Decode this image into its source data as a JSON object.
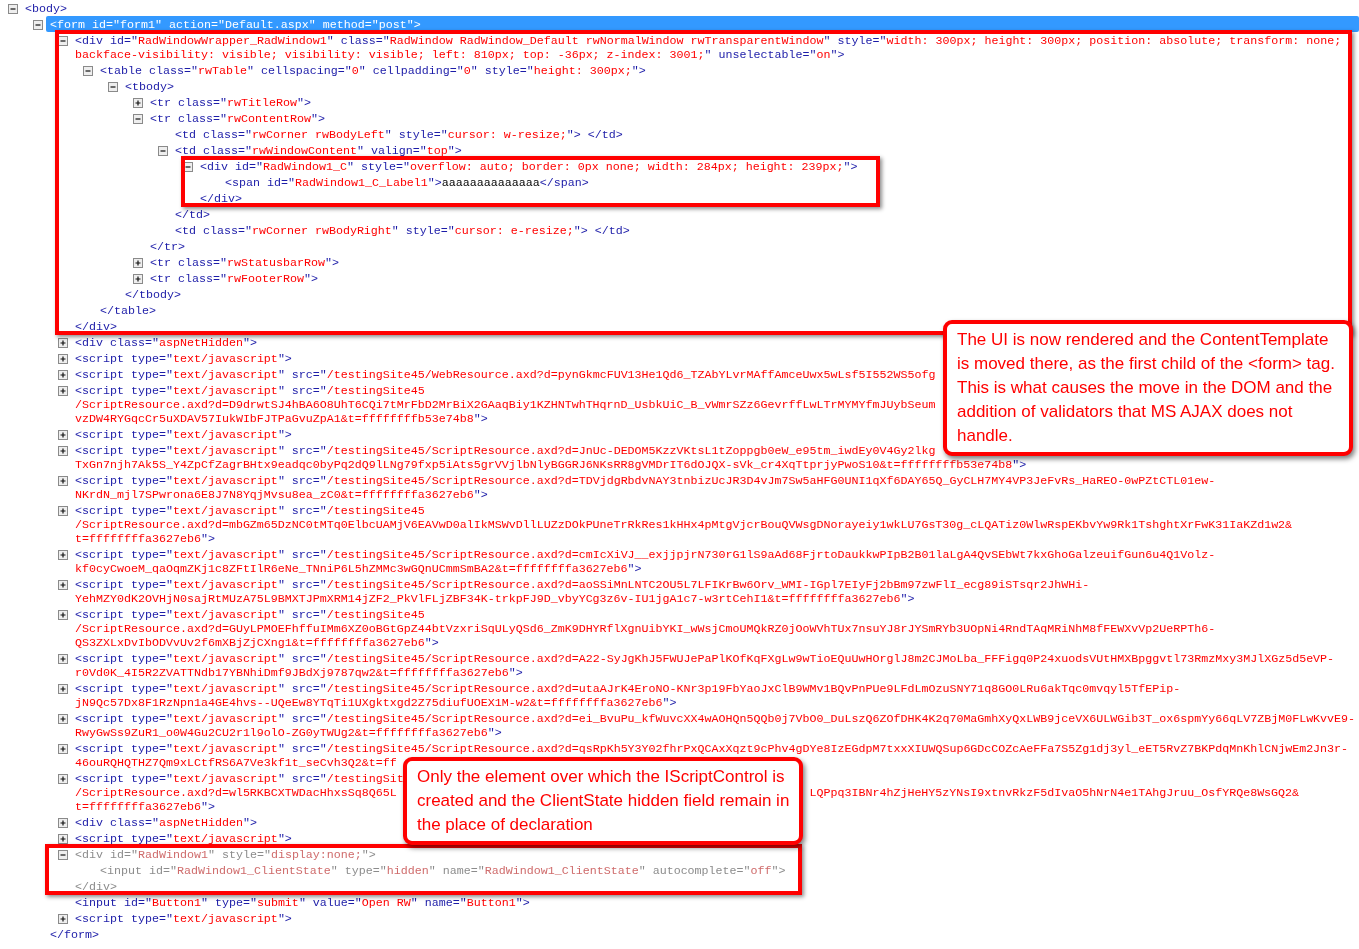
{
  "tree": [
    {
      "lines": [
        "<body>"
      ],
      "expanded": true,
      "selected": false,
      "dimmed": false,
      "outlined": false,
      "children": [
        {
          "lines": [
            "<form id=\"form1\" action=\"Default.aspx\" method=\"post\">"
          ],
          "expanded": true,
          "selected": true,
          "dimmed": false,
          "outlined": false,
          "children": [
            {
              "lines": [
                "<div id=\"RadWindowWrapper_RadWindow1\" class=\"RadWindow RadWindow_Default rwNormalWindow rwTransparentWindow\" style=\"width: 300px; height: 300px; position: absolute; transform: none;",
                "backface-visibility: visible; visibility: visible; left: 810px; top: -36px; z-index: 3001;\" unselectable=\"on\">"
              ],
              "expanded": true,
              "selected": false,
              "dimmed": false,
              "outlined": true,
              "children": [
                {
                  "lines": [
                    "<table class=\"rwTable\" cellspacing=\"0\" cellpadding=\"0\" style=\"height: 300px;\">"
                  ],
                  "expanded": true,
                  "selected": false,
                  "dimmed": false,
                  "outlined": false,
                  "children": [
                    {
                      "lines": [
                        "<tbody>"
                      ],
                      "expanded": true,
                      "selected": false,
                      "dimmed": false,
                      "outlined": false,
                      "children": [
                        {
                          "lines": [
                            "<tr class=\"rwTitleRow\">"
                          ],
                          "expanded": false,
                          "selected": false,
                          "dimmed": false,
                          "outlined": false
                        },
                        {
                          "lines": [
                            "<tr class=\"rwContentRow\">"
                          ],
                          "expanded": true,
                          "selected": false,
                          "dimmed": false,
                          "outlined": false,
                          "children": [
                            {
                              "lines": [
                                "<td class=\"rwCorner rwBodyLeft\" style=\"cursor: w-resize;\"> </td>"
                              ],
                              "selected": false,
                              "dimmed": false,
                              "outlined": false
                            },
                            {
                              "lines": [
                                "<td class=\"rwWindowContent\" valign=\"top\">"
                              ],
                              "expanded": true,
                              "selected": false,
                              "dimmed": false,
                              "outlined": false,
                              "children": [
                                {
                                  "lines": [
                                    "<div id=\"RadWindow1_C\" style=\"overflow: auto; border: 0px none; width: 284px; height: 239px;\">"
                                  ],
                                  "expanded": true,
                                  "selected": false,
                                  "dimmed": false,
                                  "outlined": true,
                                  "children": [
                                    {
                                      "lines": [
                                        "<span id=\"RadWindow1_C_Label1\">aaaaaaaaaaaaaa</span>"
                                      ],
                                      "selected": false,
                                      "dimmed": false,
                                      "outlined": false
                                    }
                                  ],
                                  "closing": "</div>"
                                }
                              ],
                              "closing": "</td>"
                            },
                            {
                              "lines": [
                                "<td class=\"rwCorner rwBodyRight\" style=\"cursor: e-resize;\"> </td>"
                              ],
                              "selected": false,
                              "dimmed": false,
                              "outlined": false
                            }
                          ],
                          "closing": "</tr>"
                        },
                        {
                          "lines": [
                            "<tr class=\"rwStatusbarRow\">"
                          ],
                          "expanded": false,
                          "selected": false,
                          "dimmed": false,
                          "outlined": false
                        },
                        {
                          "lines": [
                            "<tr class=\"rwFooterRow\">"
                          ],
                          "expanded": false,
                          "selected": false,
                          "dimmed": false,
                          "outlined": false
                        }
                      ],
                      "closing": "</tbody>"
                    }
                  ],
                  "closing": "</table>"
                }
              ],
              "closing": "</div>"
            },
            {
              "lines": [
                "<div class=\"aspNetHidden\">"
              ],
              "expanded": false,
              "selected": false,
              "dimmed": false,
              "outlined": false
            },
            {
              "lines": [
                "<script type=\"text/javascript\">"
              ],
              "expanded": false,
              "selected": false,
              "dimmed": false,
              "outlined": false
            },
            {
              "lines": [
                "<script type=\"text/javascript\" src=\"/testingSite45/WebResource.axd?d=pynGkmcFUV13He1Qd6_TZAbYLvrMAffAmceUwx5wLsf5I552WS5ofg"
              ],
              "expanded": false,
              "selected": false,
              "dimmed": false,
              "outlined": false
            },
            {
              "lines": [
                "<script type=\"text/javascript\" src=\"/testingSite45",
                "/ScriptResource.axd?d=D9drwtSJ4hBA6O8UhT6CQi7tMrFbD2MrBiX2GAaqBiy1KZHNTwhTHqrnD_UsbkUiC_B_vWmrSZz6GevrffLwLTrMYMYfmJUybSeum",
                "vzDW4RYGqcCr5uXDAV57IukWIbFJTPaGvuZpA1&t=ffffffffb53e74b8\">"
              ],
              "expanded": false,
              "selected": false,
              "dimmed": false,
              "outlined": false
            },
            {
              "lines": [
                "<script type=\"text/javascript\">"
              ],
              "expanded": false,
              "selected": false,
              "dimmed": false,
              "outlined": false
            },
            {
              "lines": [
                "<script type=\"text/javascript\" src=\"/testingSite45/ScriptResource.axd?d=JnUc-DEDOM5KzzVKtsL1tZoppgb0eW_e95tm_iwdEy0V4Gy2lkg",
                "TxGn7njh7Ak5S_Y4ZpCfZagrBHtx9eadqc0byPq2dQ9lLNg79fxp5iAts5grVVjlbNlyBGGRJ6NKsRR8gVMDrIT6dOJQX-sVk_cr4XqTtprjyPwoS10&t=ffffffffb53e74b8\">"
              ],
              "expanded": false,
              "selected": false,
              "dimmed": false,
              "outlined": false
            },
            {
              "lines": [
                "<script type=\"text/javascript\" src=\"/testingSite45/ScriptResource.axd?d=TDVjdgRbdvNAY3tnbizUcJR3D4vJm7Sw5aHFG0UNI1qXf6DAY65Q_GyCLH7MY4VP3JeFvRs_HaREO-0wPZtCTL01ew-",
                "NKrdN_mjl7SPwrona6E8J7N8YqjMvsu8ea_zC0&t=ffffffffa3627eb6\">"
              ],
              "expanded": false,
              "selected": false,
              "dimmed": false,
              "outlined": false
            },
            {
              "lines": [
                "<script type=\"text/javascript\" src=\"/testingSite45",
                "/ScriptResource.axd?d=mbGZm65DzNC0tMTq0ElbcUAMjV6EAVwD0alIkMSWvDllLUZzDOkPUneTrRkRes1kHHx4pMtgVjcrBouQVWsgDNorayeiy1wkLU7GsT30g_cLQATiz0WlwRspEKbvYw9Rk1TshghtXrFwK31IaKZd1w2&",
                "t=ffffffffa3627eb6\">"
              ],
              "expanded": false,
              "selected": false,
              "dimmed": false,
              "outlined": false
            },
            {
              "lines": [
                "<script type=\"text/javascript\" src=\"/testingSite45/ScriptResource.axd?d=cmIcXiVJ__exjjpjrN730rG1lS9aAd68FjrtoDaukkwPIpB2B01laLgA4QvSEbWt7kxGhoGalzeuifGun6u4Q1Volz-",
                "kf0cyCwoeM_qaOqmZKj1c8ZFtIlR6eNe_TNniP6L5hZMMc3wGQnUCmmSmBA2&t=ffffffffa3627eb6\">"
              ],
              "expanded": false,
              "selected": false,
              "dimmed": false,
              "outlined": false
            },
            {
              "lines": [
                "<script type=\"text/javascript\" src=\"/testingSite45/ScriptResource.axd?d=aoSSiMnLNTC2OU5L7LFIKrBw6Orv_WMI-IGpl7EIyFj2bBm97zwFlI_ecg89iSTsqr2JhWHi-",
                "YehMZY0dK2OVHjN0sajRtMUzA75L9BMXTJPmXRM14jZF2_PkVlFLjZBF34K-trkpFJ9D_vbyYCg3z6v-IU1jgA1c7-w3rtCehI1&t=ffffffffa3627eb6\">"
              ],
              "expanded": false,
              "selected": false,
              "dimmed": false,
              "outlined": false
            },
            {
              "lines": [
                "<script type=\"text/javascript\" src=\"/testingSite45",
                "/ScriptResource.axd?d=GUyLPMOEFhffuIMm6XZ0oBGtGpZ44btVzxriSqULyQSd6_ZmK9DHYRflXgnUibYKI_wWsjCmoUMQkRZ0jOoWVhTUx7nsuYJ8rJYSmRYb3UOpNi4RndTAqMRiNhM8fFEWXvVp2UeRPTh6-",
                "QS3ZXLxDvIbODVvUv2f6mXBjZjCXng1&t=ffffffffa3627eb6\">"
              ],
              "expanded": false,
              "selected": false,
              "dimmed": false,
              "outlined": false
            },
            {
              "lines": [
                "<script type=\"text/javascript\" src=\"/testingSite45/ScriptResource.axd?d=A22-SyJgKhJ5FWUJePaPlKOfKqFXgLw9wTioEQuUwHOrglJ8m2CJMoLba_FFFigq0P24xuodsVUtHMXBpggvtl73RmzMxy3MJlXGz5d5eVP-",
                "r0Vd0K_4I5R2ZVATTNdb17YBNhiDmf9JBdXj9787qw2&t=ffffffffa3627eb6\">"
              ],
              "expanded": false,
              "selected": false,
              "dimmed": false,
              "outlined": false
            },
            {
              "lines": [
                "<script type=\"text/javascript\" src=\"/testingSite45/ScriptResource.axd?d=utaAJrK4EroNO-KNr3p19FbYaoJxClB9WMv1BQvPnPUe9LFdLmOzuSNY71q8GO0LRu6akTqc0mvqyl5TfEPip-",
                "jN9Qc57Dx8F1RzNpn1a4GE4hvs--UQeEw8YTqTi1UXgktxgd2Z75diufUOEX1M-w2&t=ffffffffa3627eb6\">"
              ],
              "expanded": false,
              "selected": false,
              "dimmed": false,
              "outlined": false
            },
            {
              "lines": [
                "<script type=\"text/javascript\" src=\"/testingSite45/ScriptResource.axd?d=ei_BvuPu_kfWuvcXX4wAOHQn5QQb0j7VbO0_DuLszQ6ZOfDHK4K2q70MaGmhXyQxLWB9jceVX6ULWGib3T_ox6spmYy66qLV7ZBjM0FLwKvvE9-",
                "RwyGwSs9ZuR1_o0W4Gu2CU2r1l9olO-ZG0yTWUg2&t=ffffffffa3627eb6\">"
              ],
              "expanded": false,
              "selected": false,
              "dimmed": false,
              "outlined": false
            },
            {
              "lines": [
                "<script type=\"text/javascript\" src=\"/testingSite45/ScriptResource.axd?d=qsRpKh5Y3Y02fhrPxQCAxXqzt9cPhv4gDYe8IzEGdpM7txxXIUWQSup6GDcCOZcAeFFa7S5Zg1dj3yl_eET5RvZ7BKPdqMnKhlCNjwEm2Jn3r-",
                "46ouRQHQTHZ7Qm9xLCtfRS6A7Ve3kf1t_seCvh3Q2&t=ff"
              ],
              "expanded": false,
              "selected": false,
              "dimmed": false,
              "outlined": false
            },
            {
              "lines": [
                "<script type=\"text/javascript\" src=\"/testingSit",
                [
                  "/ScriptResource.axd?d=wl5RKBCXTWDacHhxsSq8Q65L",
                  "LQPpq3IBNr4hZjHeHY5zYNsI9xtnvRkzF5dIvaO5hNrN4e1TAhgJruu_OsfYRQe8WsGQ2&"
                ],
                "t=ffffffffa3627eb6\">"
              ],
              "expanded": false,
              "selected": false,
              "dimmed": false,
              "outlined": false
            },
            {
              "lines": [
                "<div class=\"aspNetHidden\">"
              ],
              "expanded": false,
              "selected": false,
              "dimmed": false,
              "outlined": false
            },
            {
              "lines": [
                "<script type=\"text/javascript\">"
              ],
              "expanded": false,
              "selected": false,
              "dimmed": false,
              "outlined": false
            },
            {
              "lines": [
                "<div id=\"RadWindow1\" style=\"display:none;\">"
              ],
              "expanded": true,
              "selected": false,
              "dimmed": true,
              "outlined": true,
              "children": [
                {
                  "lines": [
                    "<input id=\"RadWindow1_ClientState\" type=\"hidden\" name=\"RadWindow1_ClientState\" autocomplete=\"off\">"
                  ],
                  "selected": false,
                  "dimmed": true,
                  "outlined": false
                }
              ],
              "closing": "</div>"
            },
            {
              "lines": [
                "<input id=\"Button1\" type=\"submit\" value=\"Open RW\" name=\"Button1\">"
              ],
              "selected": false,
              "dimmed": false,
              "outlined": false
            },
            {
              "lines": [
                "<script type=\"text/javascript\">"
              ],
              "expanded": false,
              "selected": false,
              "dimmed": false,
              "outlined": false
            }
          ],
          "closing": "</form>"
        }
      ]
    }
  ],
  "callouts": [
    {
      "text": "The UI is now rendered and the ContentTemplate is moved there, as the first child of the <form> tag. This is what causes the move in the DOM and the addition of validators that MS AJAX does not handle."
    },
    {
      "text": "Only the element over which the IScriptControl is created and the ClientState hidden field remain in the place of declaration"
    }
  ]
}
